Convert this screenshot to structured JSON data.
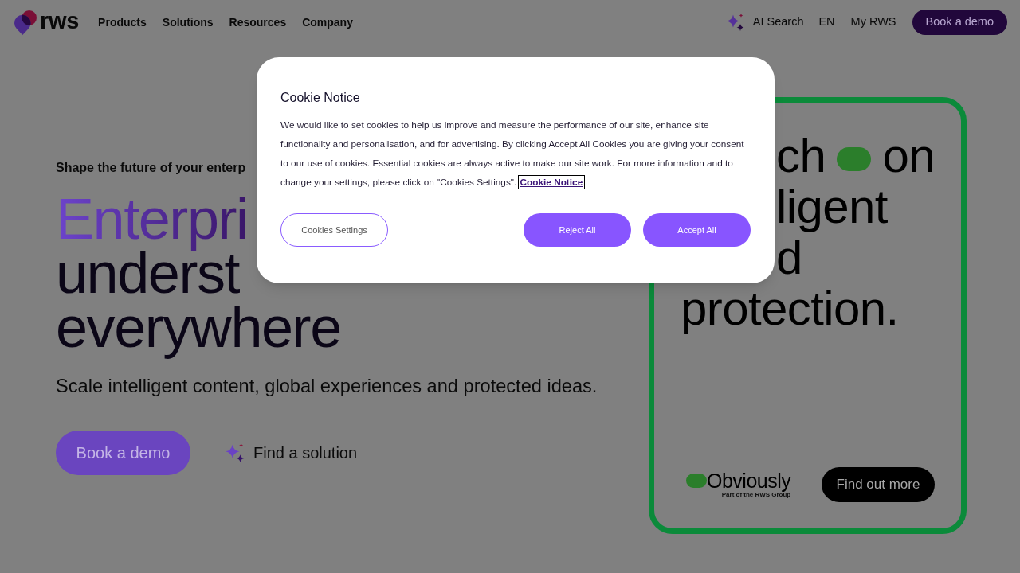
{
  "header": {
    "logo": {
      "text": "rws"
    },
    "menu": [
      "Products",
      "Solutions",
      "Resources",
      "Company"
    ],
    "ai_search": "AI Search",
    "language": "EN",
    "account": "My RWS",
    "cta": "Book a demo"
  },
  "hero": {
    "eyebrow": "Shape the future of your enterp",
    "headline": [
      {
        "text": "Enterpri",
        "kind": "gradient"
      },
      {
        "text": "underst",
        "kind": "plain"
      },
      {
        "text": "everywhere",
        "kind": "plain"
      }
    ],
    "subtitle": "Scale intelligent content, global experiences and protected ideas.",
    "primary_button": "Book a demo",
    "secondary_link": "Find a solution"
  },
  "promo_card": {
    "lines": [
      {
        "covered": true,
        "parts": [
          {
            "kind": "text",
            "text": "ch"
          },
          {
            "kind": "toggle"
          },
          {
            "kind": "text",
            "text": "on"
          }
        ]
      },
      {
        "covered": true,
        "parts": [
          {
            "kind": "text",
            "text": "ligent"
          }
        ]
      },
      {
        "covered": true,
        "parts": [
          {
            "kind": "text",
            "text": "d"
          }
        ]
      },
      {
        "covered": false,
        "parts": [
          {
            "kind": "text",
            "text": "protection."
          }
        ]
      }
    ],
    "brand": {
      "name": "Obviously",
      "tagline": "Part of the RWS Group"
    },
    "button": "Find out more"
  },
  "cookie_dialog": {
    "title": "Cookie Notice",
    "body": "We would like to set cookies to help us improve and measure the performance of our site, enhance site functionality and personalisation, and for advertising. By clicking Accept All Cookies you are giving your consent to our use of cookies. Essential cookies are always active to make our site work. For more information and to change your settings, please click on \"Cookies Settings\".",
    "link": {
      "text": "Cookie Notice",
      "focused": true
    },
    "buttons": [
      {
        "label": "Cookies Settings",
        "kind": "outline"
      },
      {
        "label": "Reject All",
        "kind": "filled"
      },
      {
        "label": "Accept All",
        "kind": "filled"
      }
    ]
  }
}
